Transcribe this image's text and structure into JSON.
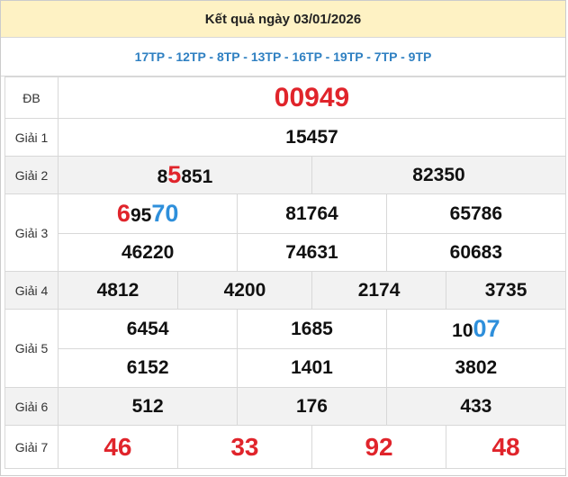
{
  "title": "Kết quả ngày 03/01/2026",
  "codes": "17TP - 12TP - 8TP - 13TP - 16TP - 19TP - 7TP - 9TP",
  "labels": {
    "db": "ĐB",
    "g1": "Giải 1",
    "g2": "Giải 2",
    "g3": "Giải 3",
    "g4": "Giải 4",
    "g5": "Giải 5",
    "g6": "Giải 6",
    "g7": "Giải 7"
  },
  "db": "00949",
  "g1": "15457",
  "g2": [
    {
      "pre": "8",
      "hl": "5",
      "post": "851"
    },
    {
      "pre": "82350",
      "hl": "",
      "post": ""
    }
  ],
  "g3": [
    {
      "pre": "",
      "hl": "6",
      "mid": "95",
      "hl2": "70"
    },
    {
      "pre": "81764"
    },
    {
      "pre": "65786"
    },
    {
      "pre": "46220"
    },
    {
      "pre": "74631"
    },
    {
      "pre": "60683"
    }
  ],
  "g4": [
    "4812",
    "4200",
    "2174",
    "3735"
  ],
  "g5": [
    {
      "pre": "6454"
    },
    {
      "pre": "1685"
    },
    {
      "pre": "10",
      "hl": "07"
    },
    {
      "pre": "6152"
    },
    {
      "pre": "1401"
    },
    {
      "pre": "3802"
    }
  ],
  "g6": [
    "512",
    "176",
    "433"
  ],
  "g7": [
    "46",
    "33",
    "92",
    "48"
  ]
}
